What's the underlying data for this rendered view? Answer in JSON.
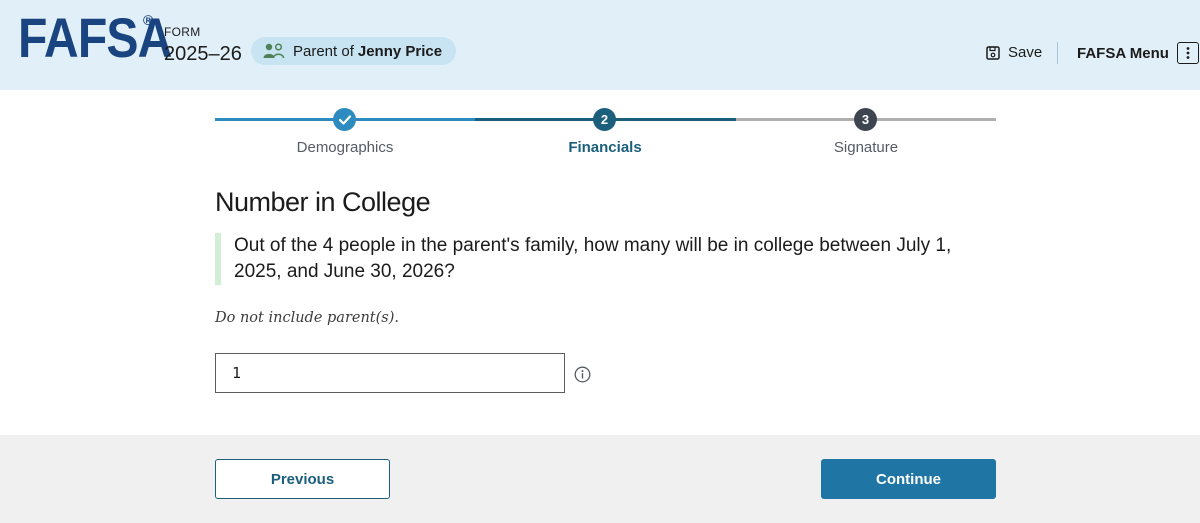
{
  "header": {
    "logo": "FAFSA",
    "registered_mark": "®",
    "form_label": "FORM",
    "form_year": "2025–26",
    "role_prefix": "Parent of",
    "student_name": "Jenny Price",
    "save_label": "Save",
    "menu_label": "FAFSA Menu"
  },
  "progress": {
    "steps": [
      {
        "label": "Demographics",
        "status": "complete"
      },
      {
        "label": "Financials",
        "number": "2",
        "status": "current"
      },
      {
        "label": "Signature",
        "number": "3",
        "status": "upcoming"
      }
    ]
  },
  "main": {
    "title": "Number in College",
    "question": "Out of the 4 people in the parent's family, how many will be in college between July 1, 2025, and June 30, 2026?",
    "hint": "Do not include parent(s).",
    "input_value": "1"
  },
  "footer": {
    "previous_label": "Previous",
    "continue_label": "Continue"
  },
  "colors": {
    "header_bg": "#e1f0f8",
    "brand": "#1a4480",
    "primary": "#1f76a4",
    "current_step": "#1b5f7d",
    "complete_step": "#2e8bc0",
    "footer_bg": "#f0f0f0"
  }
}
